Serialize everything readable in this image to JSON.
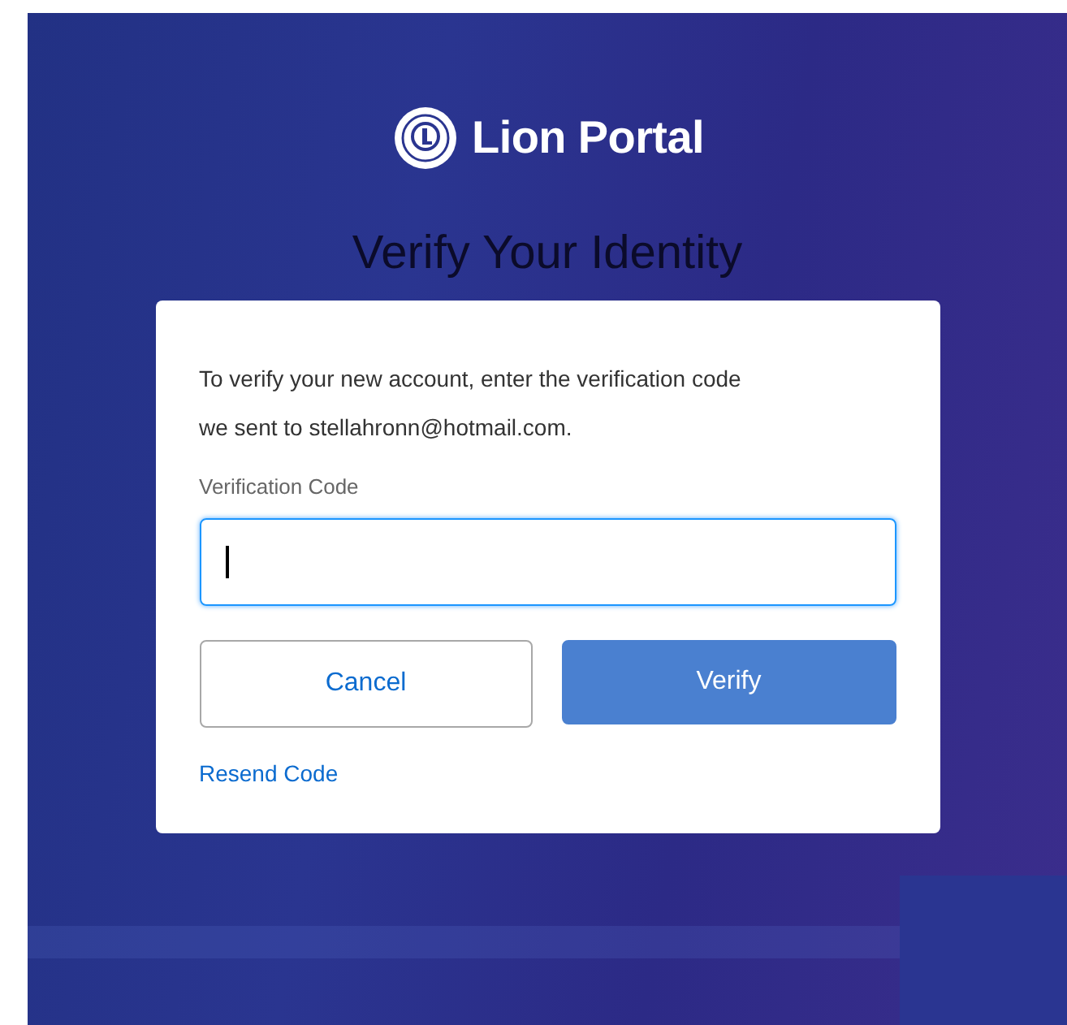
{
  "brand": {
    "name": "Lion Portal"
  },
  "heading": "Verify Your Identity",
  "card": {
    "message": "To verify your new account, enter the verification code we sent to stellahronn@hotmail.com.",
    "field": {
      "label": "Verification Code",
      "focused": true
    },
    "buttons": [
      {
        "label": "Cancel",
        "kind": "secondary"
      },
      {
        "label": "Verify",
        "kind": "primary"
      }
    ],
    "link": "Resend Code"
  }
}
